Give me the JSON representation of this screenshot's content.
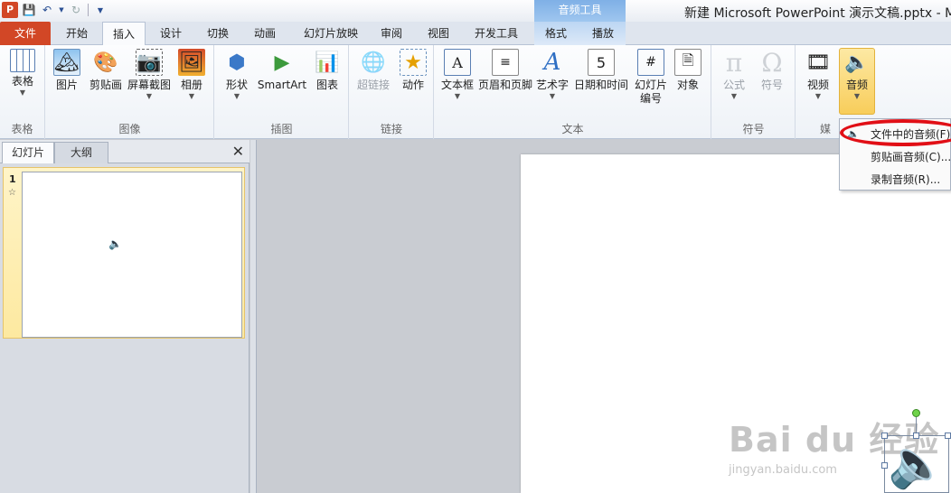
{
  "title_bar": {
    "app_logo": "P",
    "context_group": "音频工具",
    "window_title": "新建 Microsoft PowerPoint 演示文稿.pptx - Mic"
  },
  "tabs": [
    {
      "label": "文件"
    },
    {
      "label": "开始"
    },
    {
      "label": "插入"
    },
    {
      "label": "设计"
    },
    {
      "label": "切换"
    },
    {
      "label": "动画"
    },
    {
      "label": "幻灯片放映"
    },
    {
      "label": "审阅"
    },
    {
      "label": "视图"
    },
    {
      "label": "开发工具"
    },
    {
      "label": "格式"
    },
    {
      "label": "播放"
    }
  ],
  "ribbon": {
    "groups": {
      "table": "表格",
      "images": "图像",
      "illustrations": "插图",
      "links": "链接",
      "text": "文本",
      "symbols": "符号",
      "media": "媒"
    },
    "buttons": {
      "table": "表格",
      "picture": "图片",
      "clipart": "剪贴画",
      "screenshot": "屏幕截图",
      "album": "相册",
      "shapes": "形状",
      "smartart": "SmartArt",
      "chart": "图表",
      "hyperlink": "超链接",
      "action": "动作",
      "textbox": "文本框",
      "header_footer": "页眉和页脚",
      "wordart": "艺术字",
      "datetime": "日期和时间",
      "slide_number_1": "幻灯片",
      "slide_number_2": "编号",
      "object": "对象",
      "equation": "公式",
      "symbol": "符号",
      "video": "视频",
      "audio": "音频"
    }
  },
  "audio_menu": {
    "items": [
      "文件中的音频(F)...",
      "剪贴画音频(C)...",
      "录制音频(R)..."
    ]
  },
  "left_panel": {
    "tabs": [
      "幻灯片",
      "大纲"
    ],
    "close": "✕",
    "slide_number": "1",
    "slide_marker": "☆"
  },
  "watermark": {
    "main": "Bai du 经验",
    "sub": "jingyan.baidu.com"
  },
  "colors": {
    "file_tab": "#d24726",
    "context_tab": "#7fb0e6",
    "highlight": "#f8cd5a",
    "annotation_red": "#e10f16"
  }
}
